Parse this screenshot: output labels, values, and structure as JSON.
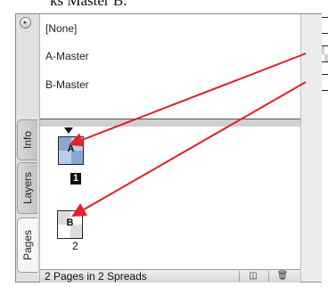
{
  "caption": "ks Master B.",
  "panel": {
    "menu_icon": "▸",
    "tabs": [
      {
        "label": "Info"
      },
      {
        "label": "Layers"
      },
      {
        "label": "Pages"
      }
    ],
    "masters": [
      {
        "label": "[None]"
      },
      {
        "label": "A-Master"
      },
      {
        "label": "B-Master"
      }
    ],
    "pages": [
      {
        "thumb_prefix": "A",
        "number": "1",
        "selected": true
      },
      {
        "thumb_prefix": "B",
        "number": "2",
        "selected": false
      }
    ],
    "status": {
      "text": "2 Pages in 2 Spreads",
      "new_page_icon": "◫",
      "trash_icon": "🗑"
    }
  },
  "colors": {
    "arrow": "#e0202a",
    "selection": "#88a9d8"
  },
  "icons": [
    "panel-menu-icon",
    "new-page-icon",
    "trash-icon",
    "arrow-annotation"
  ]
}
